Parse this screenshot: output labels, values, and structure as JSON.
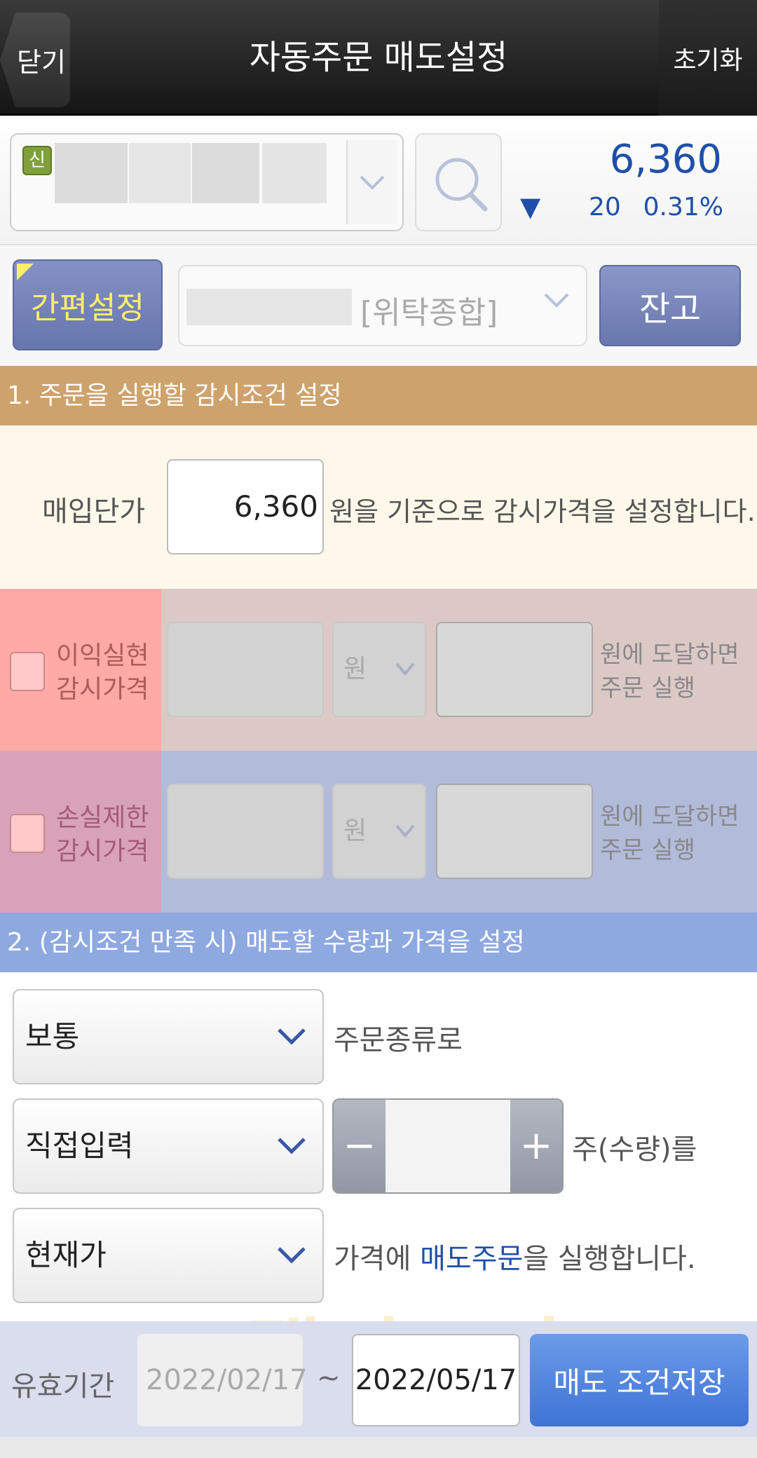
{
  "header": {
    "close_label": "닫기",
    "title": "자동주문 매도설정",
    "reset_label": "초기화"
  },
  "stock": {
    "badge": "신",
    "price": "6,360",
    "arrow": "▼",
    "change": "20",
    "change_pct": "0.31%"
  },
  "account": {
    "easy_label": "간편설정",
    "account_type": "[위탁종합]",
    "balance_label": "잔고"
  },
  "section1": {
    "title": "1. 주문을 실행할 감시조건 설정",
    "base_label": "매입단가",
    "base_value": "6,360",
    "base_suffix": "원을 기준으로 감시가격을 설정합니다.",
    "profit": {
      "label_line1": "이익실현",
      "label_line2": "감시가격",
      "unit": "원",
      "text_line1": "원에 도달하면",
      "text_line2": "주문 실행"
    },
    "loss": {
      "label_line1": "손실제한",
      "label_line2": "감시가격",
      "unit": "원",
      "text_line1": "원에 도달하면",
      "text_line2": "주문 실행"
    }
  },
  "section2": {
    "title": "2. (감시조건 만족 시) 매도할 수량과 가격을 설정",
    "order_type": "보통",
    "order_type_suffix": "주문종류로",
    "qty_mode": "직접입력",
    "qty_suffix": "주(수량)를",
    "price_mode": "현재가",
    "price_text_before": "가격에 ",
    "price_text_highlight": "매도주문",
    "price_text_after": "을 실행합니다."
  },
  "bottom": {
    "valid_label": "유효기간",
    "date_start": "2022/02/17",
    "tilde": "~",
    "date_end": "2022/05/17",
    "save_label": "매도 조건저장"
  },
  "watermark": "랠리포이트",
  "icons": {
    "search": "search-icon",
    "chevron": "chevron-down-icon"
  }
}
